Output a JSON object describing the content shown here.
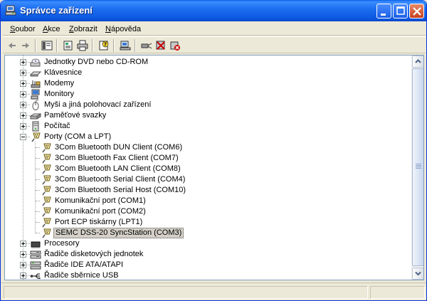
{
  "window": {
    "title": "Správce zařízení",
    "colors": {
      "titlebar": "#0b57e0",
      "selection": "#d4d0c8"
    }
  },
  "menu": [
    {
      "label": "Soubor",
      "accel": "S",
      "rest": "oubor"
    },
    {
      "label": "Akce",
      "accel": "A",
      "rest": "kce"
    },
    {
      "label": "Zobrazit",
      "accel": "Z",
      "rest": "obrazit"
    },
    {
      "label": "Nápověda",
      "accel": "N",
      "rest": "ápověda"
    }
  ],
  "toolbar": [
    {
      "name": "back-icon"
    },
    {
      "name": "forward-icon"
    },
    {
      "name": "show-hide-console-tree-icon"
    },
    {
      "name": "properties-icon"
    },
    {
      "name": "print-icon"
    },
    {
      "name": "help-icon"
    },
    {
      "name": "scan-hardware-icon"
    },
    {
      "name": "update-driver-icon"
    },
    {
      "name": "disable-device-icon"
    },
    {
      "name": "uninstall-device-icon"
    }
  ],
  "tree": [
    {
      "label": "Jednotky DVD nebo CD-ROM",
      "icon": "dvd-drive-icon",
      "level": 1,
      "expander": "closed"
    },
    {
      "label": "Klávesnice",
      "icon": "keyboard-icon",
      "level": 1,
      "expander": "closed"
    },
    {
      "label": "Modemy",
      "icon": "modem-icon",
      "level": 1,
      "expander": "closed"
    },
    {
      "label": "Monitory",
      "icon": "monitor-icon",
      "level": 1,
      "expander": "closed"
    },
    {
      "label": "Myši a jiná polohovací zařízení",
      "icon": "mouse-icon",
      "level": 1,
      "expander": "closed"
    },
    {
      "label": "Paměťové svazky",
      "icon": "storage-volume-icon",
      "level": 1,
      "expander": "closed"
    },
    {
      "label": "Počítač",
      "icon": "computer-icon",
      "level": 1,
      "expander": "closed"
    },
    {
      "label": "Porty (COM a LPT)",
      "icon": "port-icon",
      "level": 1,
      "expander": "open"
    },
    {
      "label": "3Com Bluetooth DUN Client (COM6)",
      "icon": "port-icon",
      "level": 2
    },
    {
      "label": "3Com Bluetooth Fax Client (COM7)",
      "icon": "port-icon",
      "level": 2
    },
    {
      "label": "3Com Bluetooth LAN Client (COM8)",
      "icon": "port-icon",
      "level": 2
    },
    {
      "label": "3Com Bluetooth Serial Client (COM4)",
      "icon": "port-icon",
      "level": 2
    },
    {
      "label": "3Com Bluetooth Serial Host (COM10)",
      "icon": "port-icon",
      "level": 2
    },
    {
      "label": "Komunikační port (COM1)",
      "icon": "port-icon",
      "level": 2
    },
    {
      "label": "Komunikační port (COM2)",
      "icon": "port-icon",
      "level": 2
    },
    {
      "label": "Port ECP tiskárny (LPT1)",
      "icon": "port-icon",
      "level": 2
    },
    {
      "label": "SEMC DSS-20 SyncStation (COM3)",
      "icon": "port-icon",
      "level": 2,
      "selected": true
    },
    {
      "label": "Procesory",
      "icon": "processor-icon",
      "level": 1,
      "expander": "closed"
    },
    {
      "label": "Řadiče disketových jednotek",
      "icon": "floppy-controller-icon",
      "level": 1,
      "expander": "closed"
    },
    {
      "label": "Řadiče IDE ATA/ATAPI",
      "icon": "ide-controller-icon",
      "level": 1,
      "expander": "closed"
    },
    {
      "label": "Řadiče sběrnice USB",
      "icon": "usb-controller-icon",
      "level": 1,
      "expander": "closed"
    }
  ]
}
